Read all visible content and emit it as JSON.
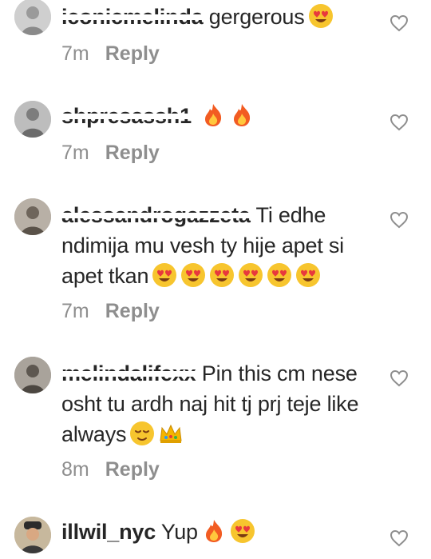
{
  "comments": [
    {
      "username": "iconicmelinda",
      "text": "gergerous",
      "emoji_trail": [
        "heart-eyes"
      ],
      "time": "7m",
      "reply_label": "Reply"
    },
    {
      "username": "shpresassh1",
      "text": "",
      "emoji_trail": [
        "fire",
        "fire"
      ],
      "time": "7m",
      "reply_label": "Reply"
    },
    {
      "username": "alessandrogazzeta",
      "text": "Ti edhe ndimija mu vesh ty hije apet si apet tkan",
      "emoji_trail": [
        "heart-eyes",
        "heart-eyes",
        "heart-eyes",
        "heart-eyes",
        "heart-eyes",
        "heart-eyes"
      ],
      "time": "7m",
      "reply_label": "Reply"
    },
    {
      "username": "melindalifexx",
      "text": "Pin this cm nese osht tu ardh naj hit tj prj teje like always",
      "emoji_trail": [
        "relieved",
        "crown"
      ],
      "time": "8m",
      "reply_label": "Reply"
    },
    {
      "username": "illwil_nyc",
      "text": "Yup",
      "emoji_trail": [
        "fire",
        "heart-eyes"
      ],
      "time": "",
      "reply_label": ""
    }
  ],
  "icons": {
    "like": "heart-outline-icon",
    "avatar": "avatar-icon"
  },
  "colors": {
    "text": "#262626",
    "meta": "#8e8e8e",
    "heart_outline": "#8e8e8e",
    "emoji_face": "#f7c52e",
    "emoji_heart": "#e8383d",
    "fire_outer": "#f25c22",
    "fire_inner": "#ffc83d",
    "crown": "#f5b400"
  }
}
